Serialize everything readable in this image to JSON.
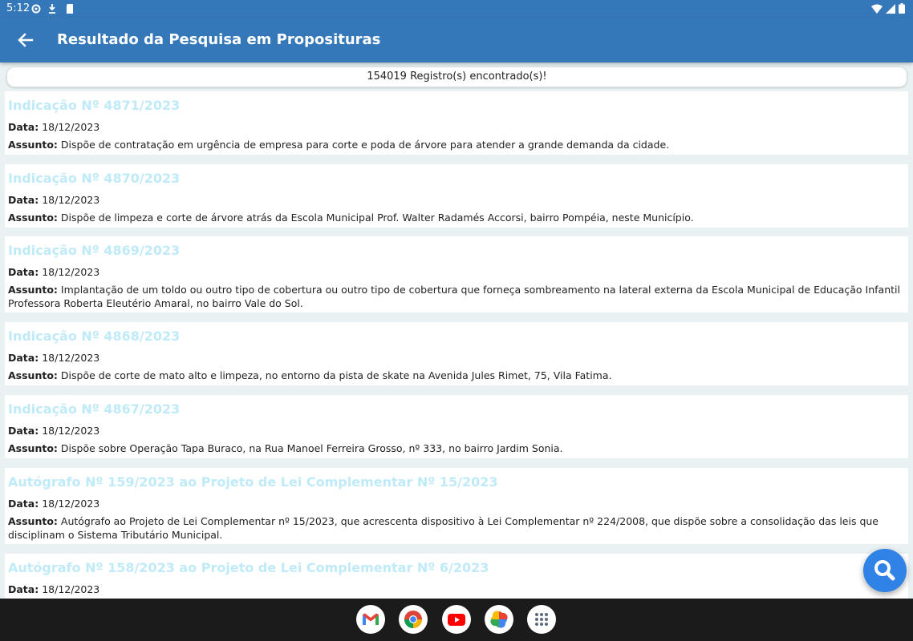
{
  "status_bar": {
    "time": "5:12"
  },
  "app_bar": {
    "title": "Resultado da Pesquisa em Proposituras"
  },
  "result_count": "154019 Registro(s) encontrado(s)!",
  "labels": {
    "date": "Data:",
    "subject": "Assunto:"
  },
  "results": [
    {
      "title": "Indicação Nº 4871/2023",
      "date": "18/12/2023",
      "subject": "Dispõe de contratação em urgência de empresa para corte e poda de árvore para atender a grande demanda da cidade."
    },
    {
      "title": "Indicação Nº 4870/2023",
      "date": "18/12/2023",
      "subject": "Dispõe de limpeza e corte de árvore atrás da Escola Municipal Prof. Walter Radamés Accorsi, bairro Pompéia, neste Município."
    },
    {
      "title": "Indicação Nº 4869/2023",
      "date": "18/12/2023",
      "subject": "Implantação de um toldo ou outro tipo de cobertura ou outro tipo de cobertura que forneça sombreamento na lateral externa da Escola Municipal de Educação Infantil Professora Roberta Eleutério Amaral, no bairro Vale do Sol."
    },
    {
      "title": "Indicação Nº 4868/2023",
      "date": "18/12/2023",
      "subject": "Dispõe de corte de mato alto e limpeza, no entorno da pista de skate na Avenida Jules Rimet, 75, Vila Fatima."
    },
    {
      "title": "Indicação Nº 4867/2023",
      "date": "18/12/2023",
      "subject": "Dispõe sobre Operação Tapa Buraco, na Rua Manoel Ferreira Grosso, nº 333, no bairro Jardim Sonia."
    },
    {
      "title": "Autógrafo Nº 159/2023 ao Projeto de Lei Complementar Nº 15/2023",
      "date": "18/12/2023",
      "subject": "Autógrafo ao Projeto de Lei Complementar nº 15/2023, que acrescenta dispositivo à Lei Complementar nº 224/2008, que dispõe sobre a consolidação das leis que disciplinam o Sistema Tributário Municipal."
    },
    {
      "title": "Autógrafo Nº 158/2023 ao Projeto de Lei Complementar Nº 6/2023",
      "date": "18/12/2023",
      "subject": ""
    }
  ],
  "colors": {
    "app_bar": "#3578b9",
    "card_title": "#bfeaf7",
    "background": "#e9f1f3",
    "fab": "#2f82e6"
  },
  "icons": {
    "back": "arrow-left-icon",
    "fab": "search-icon",
    "dock": [
      "gmail-icon",
      "chrome-icon",
      "youtube-icon",
      "photos-icon",
      "app-drawer-icon"
    ]
  }
}
